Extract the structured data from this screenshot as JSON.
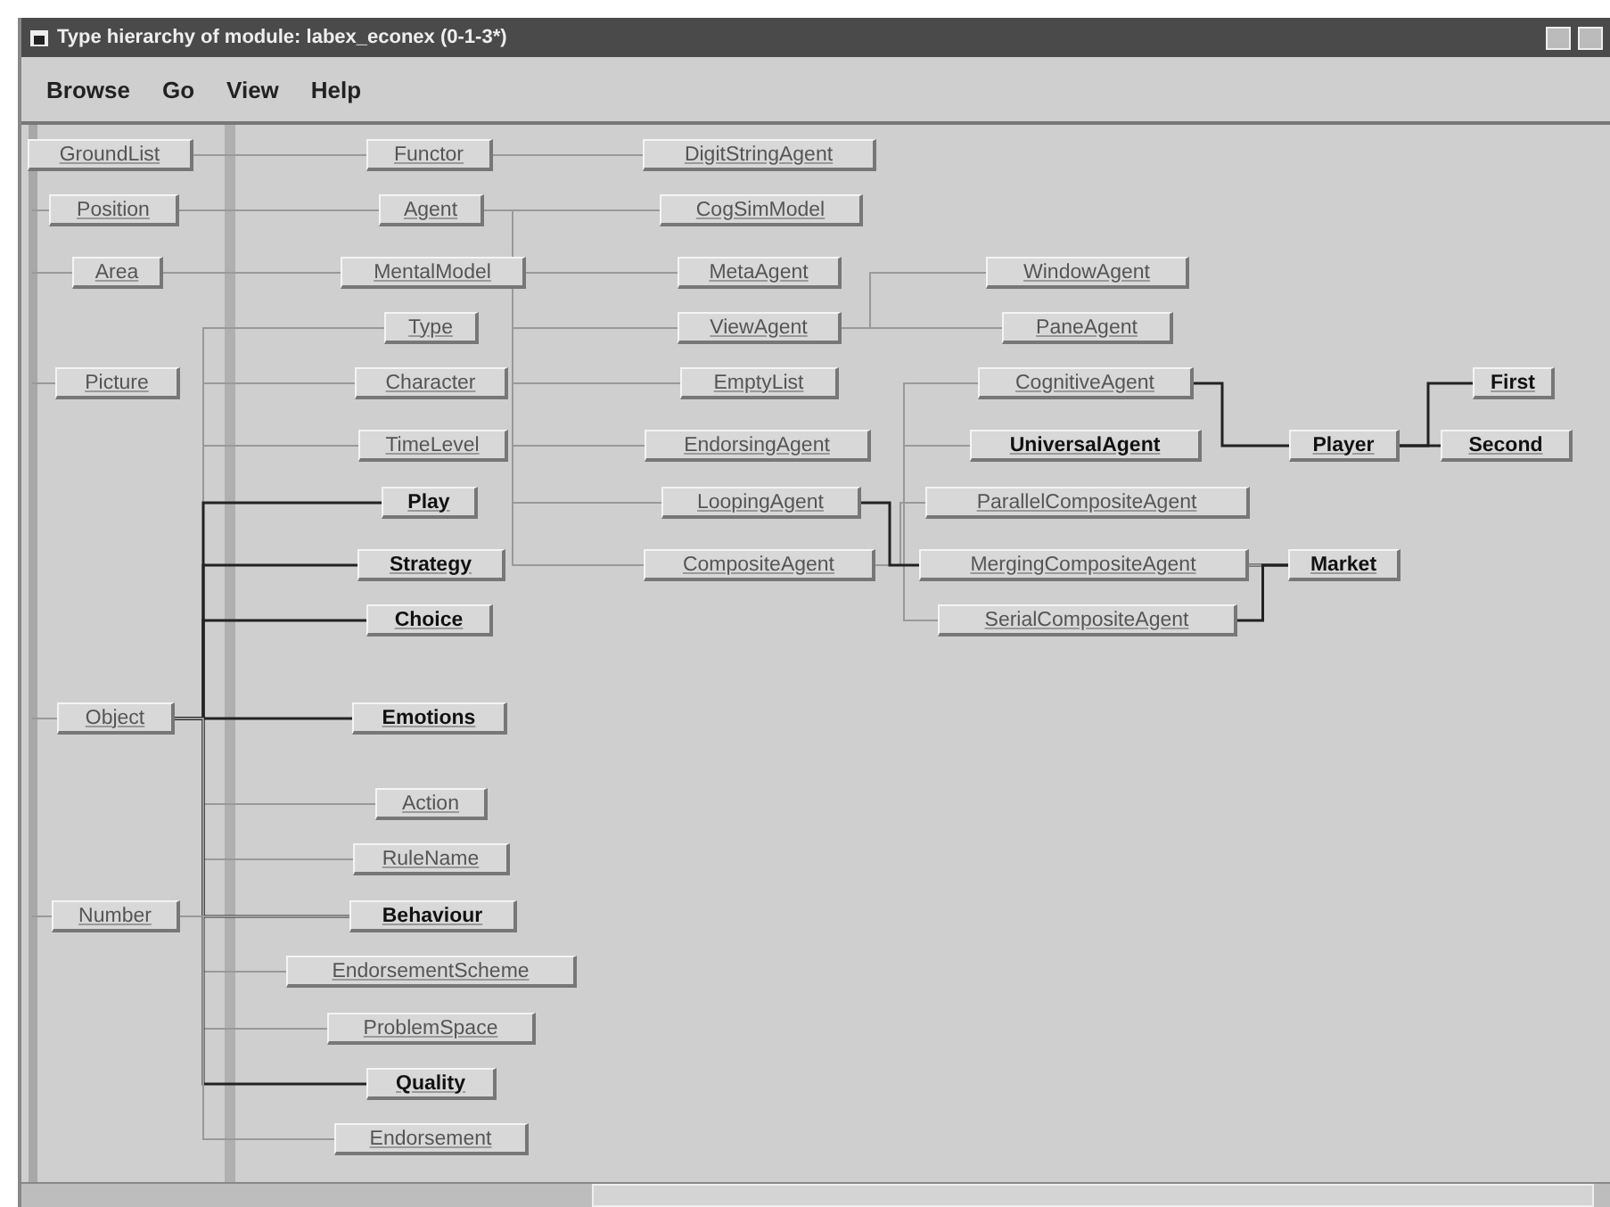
{
  "window": {
    "title": "Type hierarchy of module: labex_econex (0-1-3*)"
  },
  "menu": [
    "Browse",
    "Go",
    "View",
    "Help"
  ],
  "nodes": [
    {
      "label": "GroundList",
      "emphasized": false
    },
    {
      "label": "Position",
      "emphasized": false
    },
    {
      "label": "Area",
      "emphasized": false
    },
    {
      "label": "Picture",
      "emphasized": false
    },
    {
      "label": "Object",
      "emphasized": false
    },
    {
      "label": "Number",
      "emphasized": false
    },
    {
      "label": "Functor",
      "emphasized": false
    },
    {
      "label": "Agent",
      "emphasized": false
    },
    {
      "label": "MentalModel",
      "emphasized": false
    },
    {
      "label": "Type",
      "emphasized": false
    },
    {
      "label": "Character",
      "emphasized": false
    },
    {
      "label": "TimeLevel",
      "emphasized": false
    },
    {
      "label": "Play",
      "emphasized": true
    },
    {
      "label": "Strategy",
      "emphasized": true
    },
    {
      "label": "Choice",
      "emphasized": true
    },
    {
      "label": "Emotions",
      "emphasized": true
    },
    {
      "label": "Action",
      "emphasized": false
    },
    {
      "label": "RuleName",
      "emphasized": false
    },
    {
      "label": "Behaviour",
      "emphasized": true
    },
    {
      "label": "EndorsementScheme",
      "emphasized": false
    },
    {
      "label": "ProblemSpace",
      "emphasized": false
    },
    {
      "label": "Quality",
      "emphasized": true
    },
    {
      "label": "Endorsement",
      "emphasized": false
    },
    {
      "label": "DigitStringAgent",
      "emphasized": false
    },
    {
      "label": "CogSimModel",
      "emphasized": false
    },
    {
      "label": "MetaAgent",
      "emphasized": false
    },
    {
      "label": "ViewAgent",
      "emphasized": false
    },
    {
      "label": "EmptyList",
      "emphasized": false
    },
    {
      "label": "EndorsingAgent",
      "emphasized": false
    },
    {
      "label": "LoopingAgent",
      "emphasized": false
    },
    {
      "label": "CompositeAgent",
      "emphasized": false
    },
    {
      "label": "WindowAgent",
      "emphasized": false
    },
    {
      "label": "PaneAgent",
      "emphasized": false
    },
    {
      "label": "CognitiveAgent",
      "emphasized": false
    },
    {
      "label": "UniversalAgent",
      "emphasized": true
    },
    {
      "label": "ParallelCompositeAgent",
      "emphasized": false
    },
    {
      "label": "MergingCompositeAgent",
      "emphasized": false
    },
    {
      "label": "SerialCompositeAgent",
      "emphasized": false
    },
    {
      "label": "Player",
      "emphasized": true
    },
    {
      "label": "Market",
      "emphasized": true
    },
    {
      "label": "First",
      "emphasized": true
    },
    {
      "label": "Second",
      "emphasized": true
    }
  ]
}
